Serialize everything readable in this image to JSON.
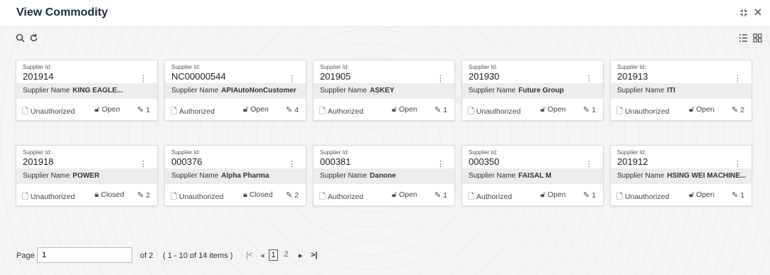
{
  "header": {
    "title": "View Commodity"
  },
  "cards": [
    {
      "id_label": "Supplier Id:",
      "id": "201914",
      "name_label": "Supplier Name",
      "name": "KING EAGLE...",
      "auth": "Unauthorized",
      "lock": "Open",
      "count": "1"
    },
    {
      "id_label": "Supplier Id:",
      "id": "NC00000544",
      "name_label": "Supplier Name",
      "name": "APIAutoNonCustomer",
      "auth": "Authorized",
      "lock": "Open",
      "count": "4"
    },
    {
      "id_label": "Supplier Id:",
      "id": "201905",
      "name_label": "Supplier Name",
      "name": "ASKEY",
      "auth": "Authorized",
      "lock": "Open",
      "count": "1"
    },
    {
      "id_label": "Supplier Id:",
      "id": "201930",
      "name_label": "Supplier Name",
      "name": "Future Group",
      "auth": "Unauthorized",
      "lock": "Open",
      "count": "1"
    },
    {
      "id_label": "Supplier Id:",
      "id": "201913",
      "name_label": "Supplier Name",
      "name": "ITI",
      "auth": "Unauthorized",
      "lock": "Open",
      "count": "2"
    },
    {
      "id_label": "Supplier Id:",
      "id": "201918",
      "name_label": "Supplier Name",
      "name": "POWER",
      "auth": "Unauthorized",
      "lock": "Closed",
      "count": "2"
    },
    {
      "id_label": "Supplier Id:",
      "id": "000376",
      "name_label": "Supplier Name",
      "name": "Alpha Pharma",
      "auth": "Unauthorized",
      "lock": "Closed",
      "count": "2"
    },
    {
      "id_label": "Supplier Id:",
      "id": "000381",
      "name_label": "Supplier Name",
      "name": "Danone",
      "auth": "Authorized",
      "lock": "Open",
      "count": "1"
    },
    {
      "id_label": "Supplier Id:",
      "id": "000350",
      "name_label": "Supplier Name",
      "name": "FAISAL M",
      "auth": "Authorized",
      "lock": "Open",
      "count": "1"
    },
    {
      "id_label": "Supplier Id:",
      "id": "201912",
      "name_label": "Supplier Name",
      "name": "HSING WEI MACHINE...",
      "auth": "Unauthorized",
      "lock": "Open",
      "count": "1"
    }
  ],
  "pager": {
    "page_label": "Page",
    "page_value": "1",
    "of_text": "of 2",
    "range_text": "( 1 - 10 of 14 items )",
    "pages": [
      "1",
      "2"
    ]
  },
  "icons": {
    "search": "search-icon",
    "refresh": "refresh-icon",
    "list_view": "list-view-icon",
    "grid_view": "grid-view-icon",
    "collapse": "collapse-icon",
    "close": "close-icon"
  }
}
